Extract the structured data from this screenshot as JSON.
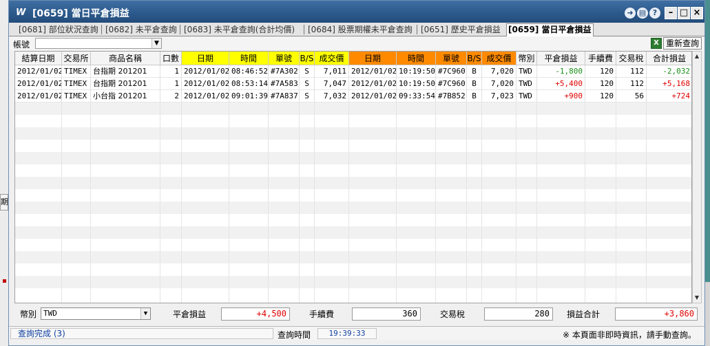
{
  "window": {
    "title": "[0659] 當日平倉損益",
    "logo": "W"
  },
  "tabs": [
    {
      "label": "[0681] 部位狀況查詢"
    },
    {
      "label": "[0682] 未平倉查詢"
    },
    {
      "label": "[0683] 未平倉查詢(合計均價)"
    },
    {
      "label": "[0684] 股票期權未平倉查詢"
    },
    {
      "label": "[0651] 歷史平倉損益"
    },
    {
      "label": "[0659] 當日平倉損益",
      "active": true
    }
  ],
  "toolbar": {
    "account_label": "帳號",
    "account_value": "",
    "requery_label": "重新查詢"
  },
  "table": {
    "columns": [
      "結算日期",
      "交易所",
      "商品名稱",
      "口數",
      "日期",
      "時間",
      "單號",
      "B/S",
      "成交價",
      "日期",
      "時間",
      "單號",
      "B/S",
      "成交價",
      "幣別",
      "平倉損益",
      "手續費",
      "交易稅",
      "合計損益"
    ],
    "rows": [
      [
        "2012/01/02",
        "TIMEX",
        "台指期 201201",
        "1",
        "2012/01/02",
        "08:46:52",
        "#7A302",
        "S",
        "7,011",
        "2012/01/02",
        "10:19:50",
        "#7C960",
        "B",
        "7,020",
        "TWD",
        "-1,800",
        "120",
        "112",
        "-2,032"
      ],
      [
        "2012/01/02",
        "TIMEX",
        "台指期 201201",
        "1",
        "2012/01/02",
        "08:53:14",
        "#7A583",
        "S",
        "7,047",
        "2012/01/02",
        "10:19:50",
        "#7C960",
        "B",
        "7,020",
        "TWD",
        "+5,400",
        "120",
        "112",
        "+5,168"
      ],
      [
        "2012/01/02",
        "TIMEX",
        "小台指 201201",
        "2",
        "2012/01/02",
        "09:01:39",
        "#7A837",
        "S",
        "7,032",
        "2012/01/02",
        "09:33:54",
        "#7B852",
        "B",
        "7,023",
        "TWD",
        "+900",
        "120",
        "56",
        "+724"
      ]
    ]
  },
  "summary": {
    "currency_label": "幣別",
    "currency_value": "TWD",
    "close_pl_label": "平倉損益",
    "close_pl_value": "+4,500",
    "fee_label": "手續費",
    "fee_value": "360",
    "tax_label": "交易稅",
    "tax_value": "280",
    "total_label": "損益合計",
    "total_value": "+3,860"
  },
  "status": {
    "state_text": "查詢完成 (3)",
    "query_time_label": "查詢時間",
    "query_time_value": "19:39:33",
    "note": "※ 本頁面非即時資訊，請手動查詢。"
  },
  "desktop": {
    "left_button_label": "期"
  },
  "colors": {
    "title_bar": "#2d5a8c",
    "open_header": "#ffff00",
    "close_header": "#ff8a00",
    "loss": "#1a8f1a",
    "profit": "#e00000"
  }
}
